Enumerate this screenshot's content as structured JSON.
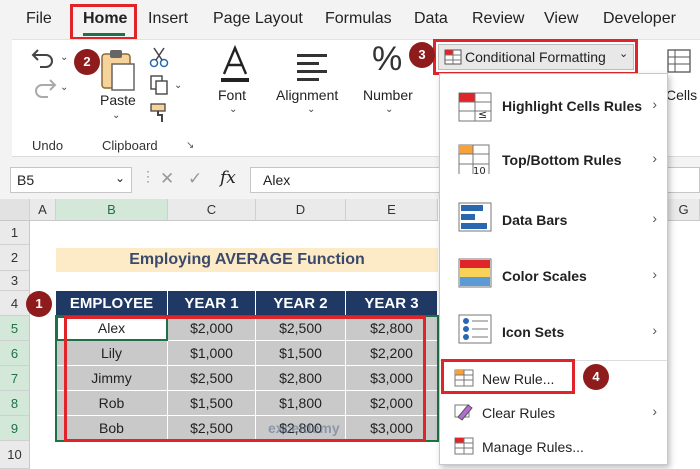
{
  "menu": {
    "items": [
      "File",
      "Home",
      "Insert",
      "Page Layout",
      "Formulas",
      "Data",
      "Review",
      "View",
      "Developer"
    ]
  },
  "ribbon": {
    "undo_label": "Undo",
    "paste_label": "Paste",
    "clipboard_label": "Clipboard",
    "font_label": "Font",
    "alignment_label": "Alignment",
    "number_label": "Number",
    "cells_label": "Cells",
    "cf_label": "Conditional Formatting"
  },
  "formula_bar": {
    "name_box": "B5",
    "fx": "fx",
    "value": "Alex"
  },
  "grid": {
    "columns": [
      "A",
      "B",
      "C",
      "D",
      "E",
      "G"
    ],
    "rows": [
      "1",
      "2",
      "3",
      "4",
      "5",
      "6",
      "7",
      "8",
      "9",
      "10"
    ],
    "title": "Employing AVERAGE Function",
    "headers": [
      "EMPLOYEE",
      "YEAR 1",
      "YEAR 2",
      "YEAR 3"
    ],
    "data": [
      [
        "Alex",
        "$2,000",
        "$2,500",
        "$2,800"
      ],
      [
        "Lily",
        "$1,000",
        "$1,500",
        "$2,200"
      ],
      [
        "Jimmy",
        "$2,500",
        "$2,800",
        "$3,000"
      ],
      [
        "Rob",
        "$1,500",
        "$1,800",
        "$2,000"
      ],
      [
        "Bob",
        "$2,500",
        "$2,800",
        "$3,000"
      ]
    ]
  },
  "dropdown": {
    "items": [
      {
        "label": "Highlight Cells Rules",
        "submenu": true
      },
      {
        "label": "Top/Bottom Rules",
        "submenu": true
      },
      {
        "label": "Data Bars",
        "submenu": true
      },
      {
        "label": "Color Scales",
        "submenu": true
      },
      {
        "label": "Icon Sets",
        "submenu": true
      },
      {
        "label": "New Rule...",
        "submenu": false
      },
      {
        "label": "Clear Rules",
        "submenu": true
      },
      {
        "label": "Manage Rules...",
        "submenu": false
      }
    ],
    "submenu_arrow": "›"
  },
  "markers": [
    "1",
    "2",
    "3",
    "4"
  ],
  "colors": {
    "accent_red": "#e0252a",
    "marker": "#8e1c1c",
    "header_navy": "#1f3864",
    "title_fill": "#fdebc8",
    "excel_green": "#1e7145"
  }
}
